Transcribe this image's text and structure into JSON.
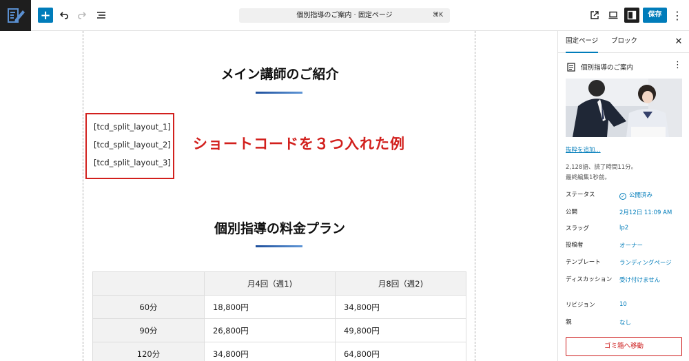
{
  "toolbar": {
    "add_icon": "plus-icon",
    "undo_icon": "undo-icon",
    "redo_icon": "redo-icon",
    "list_icon": "list-view-icon",
    "document_title": "個別指導のご案内 · 固定ページ",
    "shortcut": "⌘K",
    "save_label": "保存"
  },
  "content": {
    "heading1": "メイン講師のご紹介",
    "shortcodes": [
      "[tcd_split_layout_1]",
      "[tcd_split_layout_2]",
      "[tcd_split_layout_3]"
    ],
    "annotation": "ショートコードを３つ入れた例",
    "heading2": "個別指導の料金プラン",
    "table": {
      "headers": [
        "",
        "月4回（週1)",
        "月8回（週2)"
      ],
      "rows": [
        [
          "60分",
          "18,800円",
          "34,800円"
        ],
        [
          "90分",
          "26,800円",
          "49,800円"
        ],
        [
          "120分",
          "34,800円",
          "64,800円"
        ]
      ]
    }
  },
  "sidebar": {
    "tabs": [
      "固定ページ",
      "ブロック"
    ],
    "doc_title": "個別指導のご案内",
    "excerpt_link": "抜粋を追加...",
    "stats_line1": "2,128語、読了時間11分。",
    "stats_line2": "最終編集1秒前。",
    "meta": [
      {
        "key": "ステータス",
        "value": "公開済み"
      },
      {
        "key": "公開",
        "value": "2月12日 11:09 AM"
      },
      {
        "key": "スラッグ",
        "value": "lp2"
      },
      {
        "key": "投稿者",
        "value": "オーナー"
      },
      {
        "key": "テンプレート",
        "value": "ランディングページ"
      },
      {
        "key": "ディスカッション",
        "value": "受け付けません"
      },
      {
        "key": "リビジョン",
        "value": "10"
      },
      {
        "key": "親",
        "value": "なし"
      }
    ],
    "trash_label": "ゴミ箱へ移動"
  },
  "colors": {
    "accent": "#007cba",
    "annotation_red": "#d2201d",
    "trash_red": "#cc1818"
  }
}
